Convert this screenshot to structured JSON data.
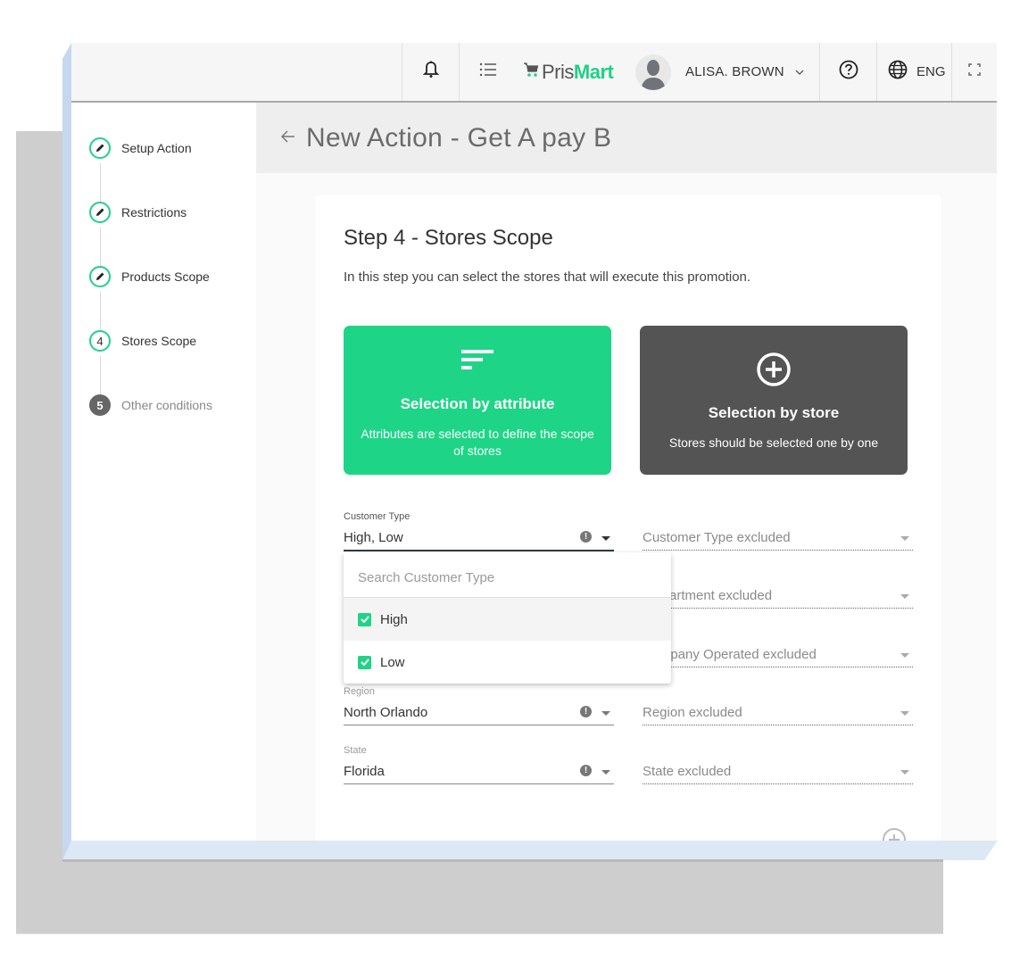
{
  "header": {
    "brand_part1": "Pris",
    "brand_part2": "Mart",
    "username": "ALISA. BROWN",
    "language": "ENG",
    "icons": [
      "bell-icon",
      "menu-list-icon",
      "cart-icon",
      "avatar",
      "chevron-down-icon",
      "help-icon",
      "globe-icon",
      "fullscreen-icon"
    ]
  },
  "sidebar": {
    "steps": [
      {
        "label": "Setup Action",
        "status": "done",
        "marker": "pencil-icon"
      },
      {
        "label": "Restrictions",
        "status": "done",
        "marker": "pencil-icon"
      },
      {
        "label": "Products Scope",
        "status": "done",
        "marker": "pencil-icon"
      },
      {
        "label": "Stores Scope",
        "status": "current",
        "number": "4"
      },
      {
        "label": "Other conditions",
        "status": "disabled",
        "number": "5"
      }
    ]
  },
  "page": {
    "title": "New Action - Get A pay B",
    "back_icon": "arrow-left-icon"
  },
  "step": {
    "title": "Step 4 - Stores Scope",
    "description": "In this step you can select the stores that will execute this promotion."
  },
  "options": {
    "attribute": {
      "title": "Selection by attribute",
      "subtitle": "Attributes are selected to define the scope of stores",
      "icon": "filter-list-icon",
      "color": "#1ed487"
    },
    "store": {
      "title": "Selection by store",
      "subtitle": "Stores should be selected one by one",
      "icon": "plus-circle-icon",
      "color": "#545454"
    }
  },
  "fields": {
    "customer_type": {
      "label": "Customer Type",
      "value": "High, Low"
    },
    "customer_type_excluded": {
      "placeholder": "Customer Type excluded"
    },
    "department_excluded": {
      "placeholder": "artment excluded"
    },
    "company_operated_excluded": {
      "placeholder": "ipany Operated excluded"
    },
    "region": {
      "label": "Region",
      "value": "North Orlando"
    },
    "region_excluded": {
      "placeholder": "Region excluded"
    },
    "state": {
      "label": "State",
      "value": "Florida"
    },
    "state_excluded": {
      "placeholder": "State excluded"
    }
  },
  "dropdown": {
    "search_placeholder": "Search Customer Type",
    "items": [
      {
        "label": "High",
        "checked": true
      },
      {
        "label": "Low",
        "checked": true
      }
    ]
  },
  "colors": {
    "accent": "#1ed487",
    "dark_card": "#545454"
  }
}
